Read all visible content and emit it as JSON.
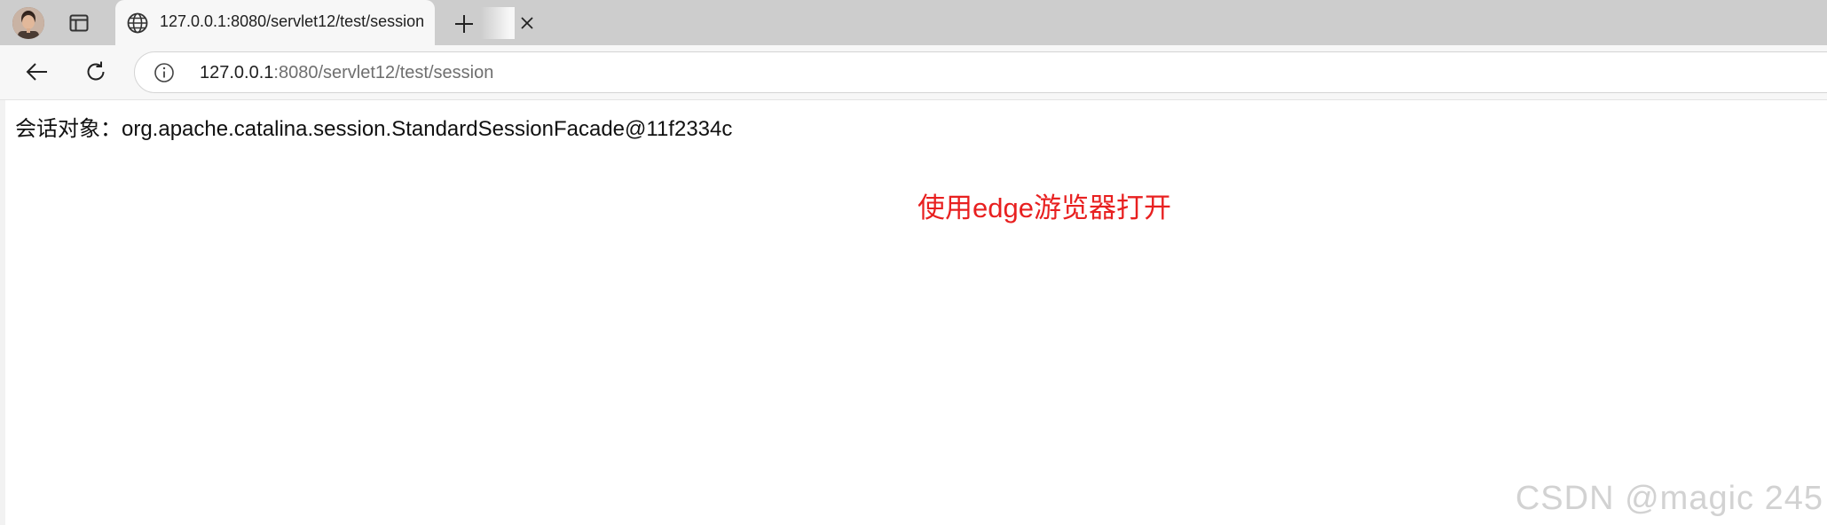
{
  "tab": {
    "title": "127.0.0.1:8080/servlet12/test/session",
    "favicon": "globe-icon",
    "close_icon": "close-icon"
  },
  "tabstrip": {
    "profile_icon": "profile-avatar",
    "tab_actions_icon": "tab-actions-icon",
    "new_tab_icon": "plus-icon"
  },
  "toolbar": {
    "back_icon": "back-arrow-icon",
    "reload_icon": "reload-icon",
    "site_info_icon": "info-icon",
    "url_host": "127.0.0.1",
    "url_rest": ":8080/servlet12/test/session"
  },
  "page": {
    "session_text": "会话对象：org.apache.catalina.session.StandardSessionFacade@11f2334c",
    "annotation": "使用edge游览器打开",
    "annotation_color": "#e82020",
    "watermark": "CSDN @magic 245"
  },
  "colors": {
    "tabstrip_bg": "#cdcdcd",
    "toolbar_bg": "#f7f7f7",
    "page_bg": "#ffffff"
  }
}
